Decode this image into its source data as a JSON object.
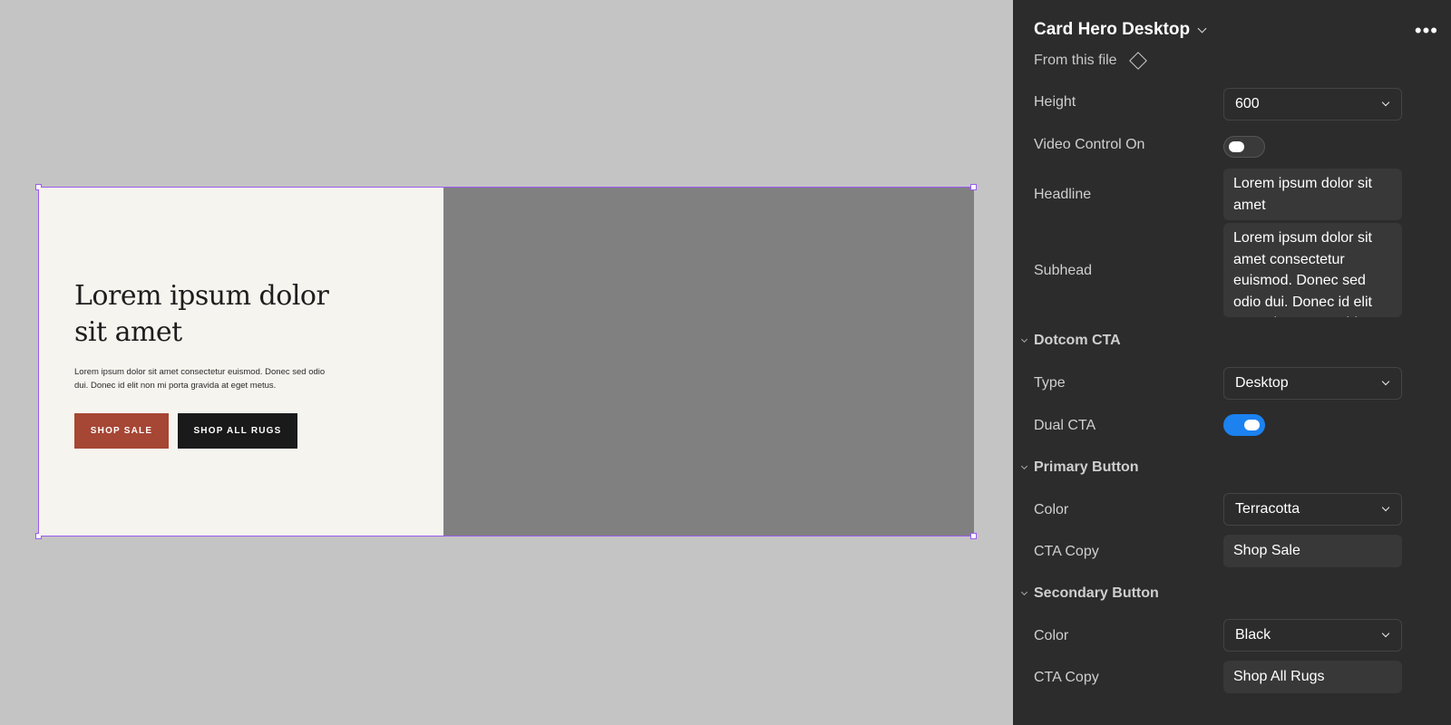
{
  "canvas": {
    "hero": {
      "headline": "Lorem ipsum dolor sit amet",
      "subhead": "Lorem ipsum dolor sit amet consectetur euismod. Donec sed odio dui. Donec id elit non mi porta gravida at eget metus.",
      "primary_cta": "SHOP SALE",
      "secondary_cta": "SHOP ALL RUGS"
    }
  },
  "panel": {
    "title": "Card Hero Desktop",
    "source": "From this file",
    "props": {
      "height_label": "Height",
      "height_value": "600",
      "video_label": "Video Control On",
      "video_on": false,
      "headline_label": "Headline",
      "headline_value": "Lorem ipsum dolor sit amet",
      "subhead_label": "Subhead",
      "subhead_value": "Lorem ipsum dolor sit amet consectetur euismod. Donec sed odio dui. Donec id elit non mi porta gravida at eget metus."
    },
    "dotcom_cta": {
      "section": "Dotcom CTA",
      "type_label": "Type",
      "type_value": "Desktop",
      "dual_label": "Dual CTA",
      "dual_on": true
    },
    "primary_button": {
      "section": "Primary Button",
      "color_label": "Color",
      "color_value": "Terracotta",
      "copy_label": "CTA Copy",
      "copy_value": "Shop Sale"
    },
    "secondary_button": {
      "section": "Secondary Button",
      "color_label": "Color",
      "color_value": "Black",
      "copy_label": "CTA Copy",
      "copy_value": "Shop All Rugs"
    }
  },
  "colors": {
    "canvas_bg": "#c4c4c4",
    "selection": "#9a5cf0",
    "terracotta": "#a64634",
    "black": "#1a1a1a",
    "panel_bg": "#2c2c2c",
    "toggle_on": "#1b82f0"
  }
}
